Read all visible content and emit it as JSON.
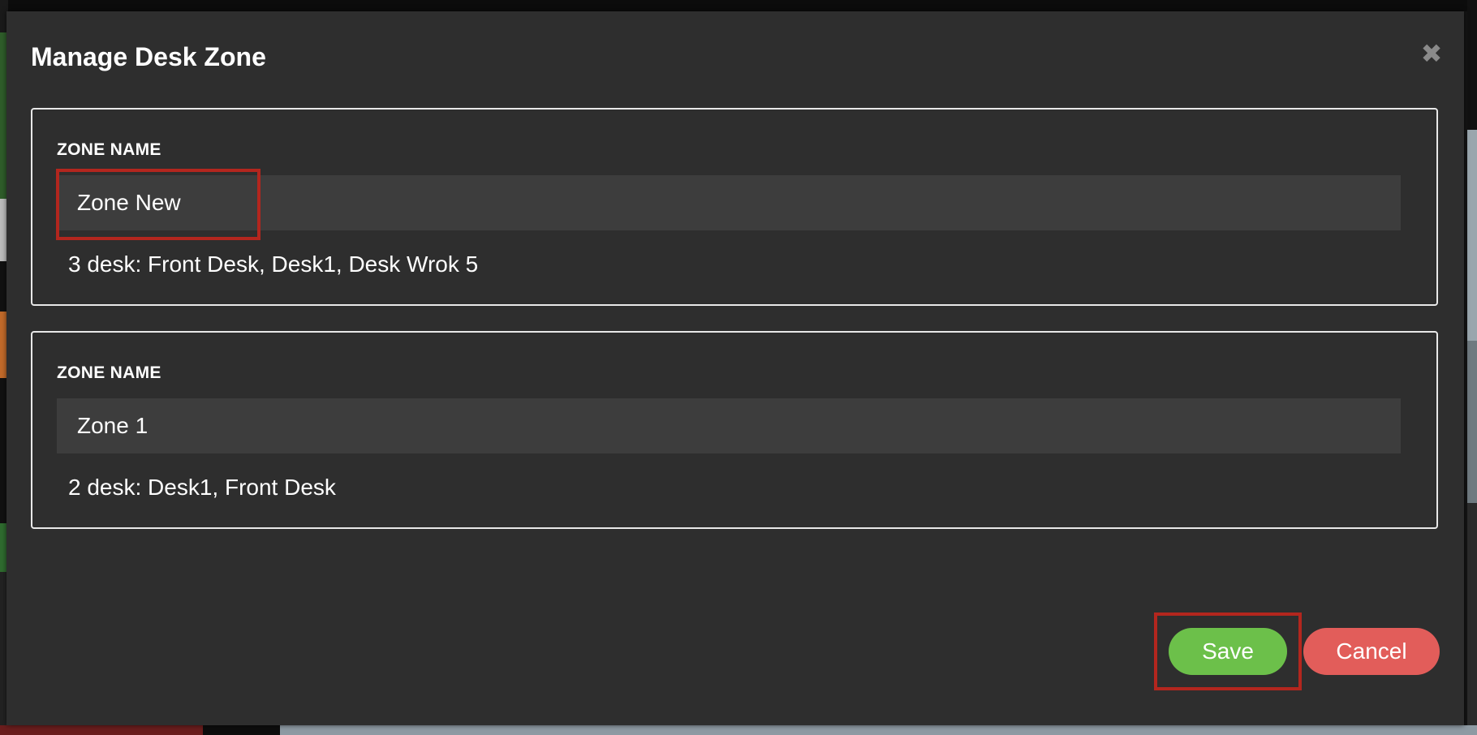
{
  "modal": {
    "title": "Manage Desk Zone",
    "close_icon": "close-icon"
  },
  "zones": [
    {
      "label": "ZONE NAME",
      "name_value": "Zone New",
      "desks_summary": "3 desk: Front Desk, Desk1, Desk Wrok 5"
    },
    {
      "label": "ZONE NAME",
      "name_value": "Zone 1",
      "desks_summary": "2 desk: Desk1, Front Desk"
    }
  ],
  "actions": {
    "save_label": "Save",
    "cancel_label": "Cancel"
  },
  "colors": {
    "modal_bg": "#2e2e2e",
    "input_bg": "#3d3d3d",
    "save": "#6cc04a",
    "cancel": "#e25d5a",
    "highlight": "#b3261e"
  }
}
